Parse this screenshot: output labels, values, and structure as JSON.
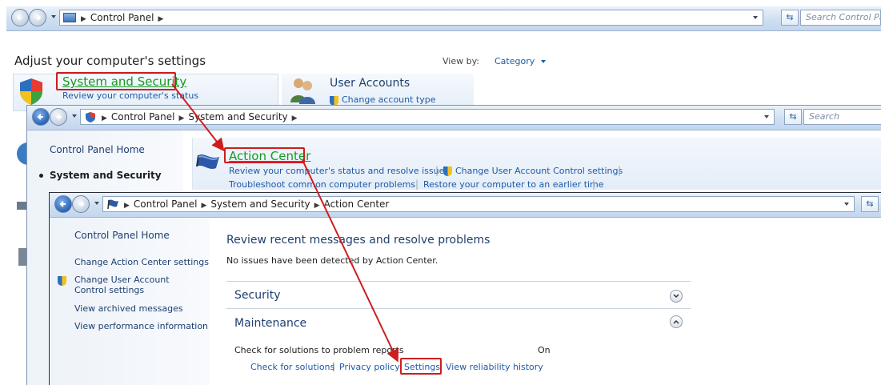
{
  "window1": {
    "breadcrumb": [
      "Control Panel"
    ],
    "search_placeholder": "Search Control Pa",
    "heading": "Adjust your computer's settings",
    "view_by_label": "View by:",
    "view_by_value": "Category",
    "system_security": {
      "title": "System and Security",
      "sub": "Review your computer's status"
    },
    "user_accounts": {
      "title": "User Accounts",
      "sub": "Change account type"
    }
  },
  "window2": {
    "breadcrumb": [
      "Control Panel",
      "System and Security"
    ],
    "search_placeholder": "Search",
    "sidebar": [
      "Control Panel Home",
      "System and Security"
    ],
    "action_center": {
      "title": "Action Center",
      "links_row1": [
        "Review your computer's status and resolve issues",
        "Change User Account Control settings"
      ],
      "links_row2": [
        "Troubleshoot common computer problems",
        "Restore your computer to an earlier time"
      ]
    }
  },
  "window3": {
    "breadcrumb": [
      "Control Panel",
      "System and Security",
      "Action Center"
    ],
    "sidebar": {
      "home": "Control Panel Home",
      "items": [
        "Change Action Center settings",
        "Change User Account Control settings",
        "View archived messages",
        "View performance information"
      ]
    },
    "title": "Review recent messages and resolve problems",
    "status": "No issues have been detected by Action Center.",
    "sections": [
      "Security",
      "Maintenance"
    ],
    "maintenance": {
      "item_label": "Check for solutions to problem reports",
      "item_value": "On",
      "links": [
        "Check for solutions",
        "Privacy policy",
        "Settings",
        "View reliability history"
      ],
      "separator": "|"
    }
  },
  "colors": {
    "accent_link": "#1c5aa8",
    "green_link": "#159a22",
    "highlight_red": "#cf1d1d"
  }
}
